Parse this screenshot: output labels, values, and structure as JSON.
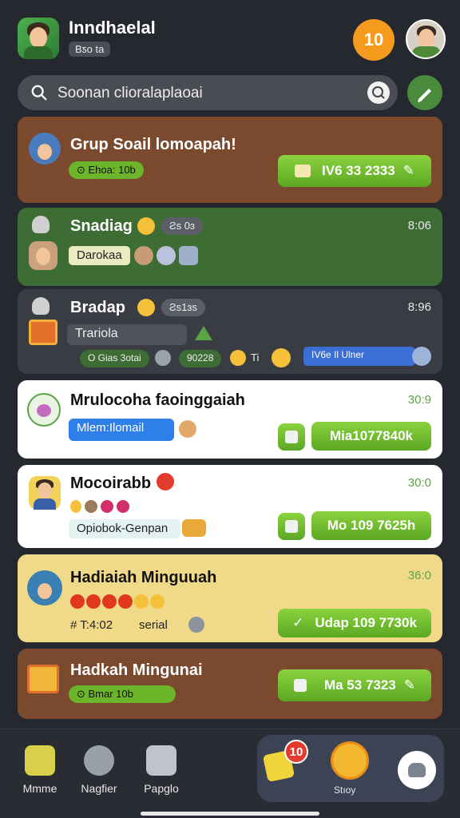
{
  "header": {
    "title": "Inndhaelal",
    "subtitle": "Bƽo ta",
    "coins": "10"
  },
  "search": {
    "placeholder": "Soonan clioralaplaoai"
  },
  "chats": [
    {
      "title": "Grup Soail lomoapah!",
      "pill": "⊙ Ehoa: 10b",
      "button": "IV6 33 2333",
      "bg": "#7b4a2e",
      "title_color": "#ffffff"
    },
    {
      "title": "Snadiag",
      "time": "8:06",
      "tag": "Ƨs 0ɜ",
      "pill": "Darokaa",
      "bg": "#3e6c35",
      "title_color": "#ffffff"
    },
    {
      "title": "Bradap",
      "time": "8:96",
      "tag": "Ƨs1ɜs",
      "pill": "Trariola",
      "pill2": "O Gias 3otai",
      "pill3": "90228",
      "pill3_suffix": "Ti",
      "pill4": "IV6e Il Ulner",
      "bg": "#3a3c44",
      "title_color": "#ffffff"
    },
    {
      "title": "Mrulocoha faoinggaiah",
      "time": "30:9",
      "pill": "Mlem:Ilomail",
      "button": "Mia1077840k",
      "bg": "#ffffff",
      "title_color": "#111111"
    },
    {
      "title": "Mocoirabb",
      "time": "30:0",
      "pill": "Opiobok-Genpan",
      "button": "Mo 109 7625h",
      "bg": "#ffffff",
      "title_color": "#111111"
    },
    {
      "title": "Hadiaiah Minguuah",
      "time": "36:0",
      "meta": "# T:4:02",
      "meta2": "serial",
      "button": "Udap 109 7730k",
      "bg": "#f1d98a",
      "title_color": "#111111"
    },
    {
      "title": "Hadkah Mingunai",
      "pill": "⊙ Bmar 10b",
      "button": "Ma 53 7323",
      "bg": "#7b4a2e",
      "title_color": "#ffffff"
    }
  ],
  "nav": {
    "home": "Mmme",
    "nagfiler": "Nagfier",
    "pagglo": "Papglo",
    "badge": "10",
    "story": "Stıoy"
  },
  "colors": {
    "accent_green": "#6cbf2c",
    "coin_orange": "#f59a1c",
    "badge_red": "#e23b2e"
  }
}
